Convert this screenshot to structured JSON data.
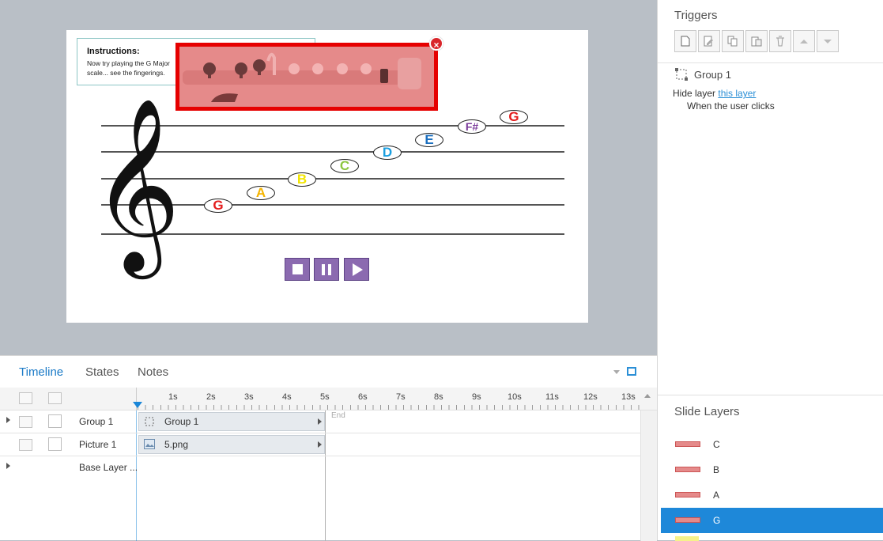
{
  "slide": {
    "instructions_title": "Instructions:",
    "instructions_body": "Now try playing the G Major scale... see the fingerings.",
    "notes": [
      "G",
      "A",
      "B",
      "C",
      "D",
      "E",
      "F#",
      "G"
    ],
    "note_colors": [
      "#e31b1b",
      "#f5b400",
      "#f2e500",
      "#8cc63f",
      "#1b9fe0",
      "#1b6fbf",
      "#7a3b9a",
      "#e31b1b"
    ]
  },
  "timeline": {
    "tabs": [
      "Timeline",
      "States",
      "Notes"
    ],
    "ticks": [
      "1s",
      "2s",
      "3s",
      "4s",
      "5s",
      "6s",
      "7s",
      "8s",
      "9s",
      "10s",
      "11s",
      "12s",
      "13s"
    ],
    "end_label": "End",
    "rows": [
      {
        "name": "Group 1",
        "bar_label": "Group 1"
      },
      {
        "name": "Picture 1",
        "bar_label": "5.png"
      },
      {
        "name": "Base Layer ..."
      }
    ]
  },
  "triggers": {
    "title": "Triggers",
    "object": "Group 1",
    "action_prefix": "Hide layer",
    "action_link": "this layer",
    "condition": "When the user clicks"
  },
  "slide_layers": {
    "title": "Slide Layers",
    "items": [
      "C",
      "B",
      "A",
      "G"
    ],
    "selected": "G"
  }
}
